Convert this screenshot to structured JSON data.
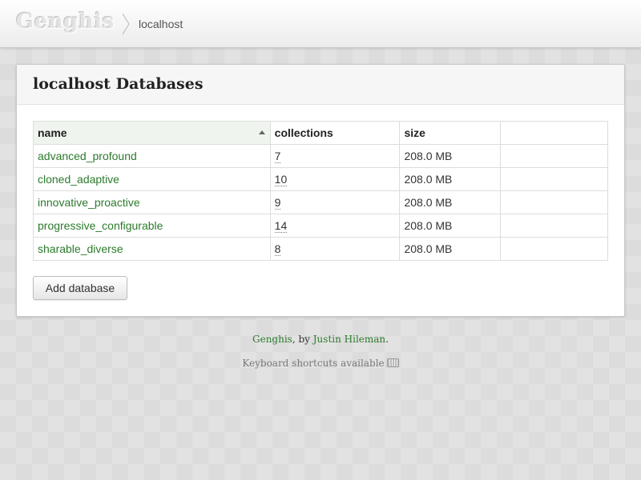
{
  "topbar": {
    "brand": "Genghis",
    "breadcrumb": "localhost"
  },
  "panel": {
    "title": "localhost Databases",
    "columns": [
      "name",
      "collections",
      "size",
      ""
    ],
    "sort": {
      "column": "name",
      "direction": "ascending"
    },
    "rows": [
      {
        "name": "advanced_profound",
        "collections": "7",
        "size": "208.0 MB"
      },
      {
        "name": "cloned_adaptive",
        "collections": "10",
        "size": "208.0 MB"
      },
      {
        "name": "innovative_proactive",
        "collections": "9",
        "size": "208.0 MB"
      },
      {
        "name": "progressive_configurable",
        "collections": "14",
        "size": "208.0 MB"
      },
      {
        "name": "sharable_diverse",
        "collections": "8",
        "size": "208.0 MB"
      }
    ],
    "add_button": "Add database"
  },
  "footer": {
    "app_link": "Genghis",
    "by_text": ", by ",
    "author_link": "Justin Hileman",
    "period": ".",
    "shortcuts_text": "Keyboard shortcuts available",
    "shortcuts_icon": "keyboard-icon"
  },
  "colors": {
    "link": "#2c7a2c",
    "background": "#dcdcdc"
  }
}
